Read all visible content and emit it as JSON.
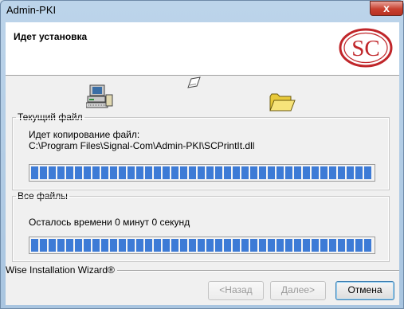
{
  "window": {
    "title": "Admin-PKI",
    "close_glyph": "x"
  },
  "header": {
    "title": "Идет установка",
    "logo_text": "SC",
    "logo_color": "#c0262a"
  },
  "icons": {
    "computer": "computer-icon",
    "paper": "paper-sheet-icon",
    "folder": "folder-icon"
  },
  "current_file": {
    "legend": "Текущий файл",
    "line1": "Идет копирование файл:",
    "path": "C:\\Program Files\\Signal-Com\\Admin-PKI\\SCPrintIt.dll",
    "progress": 1.0
  },
  "all_files": {
    "legend": "Все файлы",
    "time_left": "Осталось времени 0 минут 0 секунд",
    "progress": 1.0
  },
  "footer": {
    "brand": "Wise Installation Wizard®",
    "back_label": "<Назад",
    "next_label": "Далее>",
    "cancel_label": "Отмена"
  },
  "colors": {
    "progress_fill": "#3d7bd6",
    "titlebar": "#bcd4ea",
    "close_button": "#c8402f"
  }
}
